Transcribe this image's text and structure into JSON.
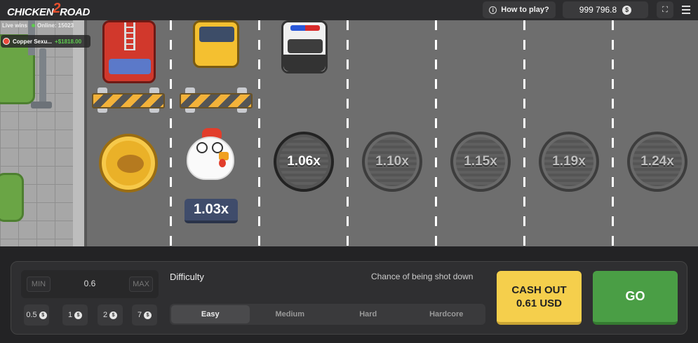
{
  "header": {
    "logo_text_a": "CHICKEN",
    "logo_text_b": "2",
    "logo_text_c": "ROAD",
    "how_to_play": "How to play?",
    "info_icon": "i",
    "balance": "999 796.8",
    "currency_symbol": "$"
  },
  "live": {
    "label": "Live wins",
    "online": "Online: 15023",
    "player": "Copper Sexu...",
    "amount": "+$1818.00"
  },
  "lanes": {
    "current_multiplier": "1.03x",
    "multipliers": [
      "1.06x",
      "1.10x",
      "1.15x",
      "1.19x",
      "1.24x"
    ]
  },
  "bet": {
    "min_label": "MIN",
    "max_label": "MAX",
    "value": "0.6",
    "quick_amounts": [
      "0.5",
      "1",
      "2",
      "7"
    ],
    "quick_symbol": "$"
  },
  "difficulty": {
    "label": "Difficulty",
    "chance_label": "Chance of being shot down",
    "options": [
      "Easy",
      "Medium",
      "Hard",
      "Hardcore"
    ],
    "selected": "Easy"
  },
  "actions": {
    "cashout_line1": "CASH OUT",
    "cashout_line2": "0.61 USD",
    "go": "GO"
  },
  "colors": {
    "cashout": "#f5cf4c",
    "go": "#4a9e45",
    "win_amount": "#5ecb4f"
  }
}
